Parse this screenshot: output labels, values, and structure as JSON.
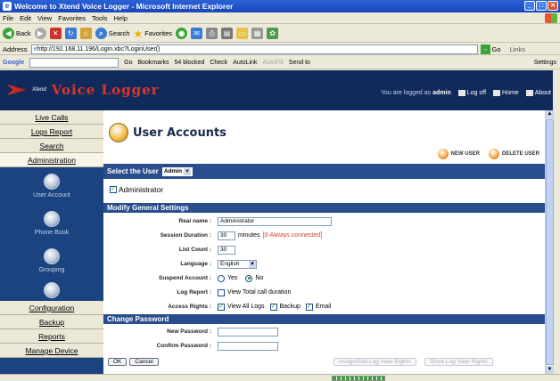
{
  "window": {
    "title": "Welcome to Xtend Voice Logger - Microsoft Internet Explorer"
  },
  "menu": [
    "File",
    "Edit",
    "View",
    "Favorites",
    "Tools",
    "Help"
  ],
  "toolbar": {
    "back": "Back",
    "search": "Search",
    "favorites": "Favorites"
  },
  "address": {
    "label": "Address",
    "url": "http://192.168.11.196/Login.xbc?LoginUser()",
    "go": "Go",
    "links": "Links"
  },
  "googlebar": {
    "brand": "Google",
    "go": "Go",
    "bookmarks": "Bookmarks",
    "blocked": "54 blocked",
    "check": "Check",
    "autolink": "AutoLink",
    "autofill": "AutoFill",
    "sendto": "Send to",
    "settings": "Settings"
  },
  "header": {
    "brand_small": "Xtend",
    "brand_big": "Voice Logger",
    "logged_in_text": "You are logged as",
    "user": "admin",
    "logoff": "Log off",
    "home": "Home",
    "about": "About"
  },
  "sidebar": {
    "top_links": [
      "Live Calls",
      "Logs Report",
      "Search",
      "Administration"
    ],
    "items": [
      "User Account",
      "Phone Book",
      "Grouping"
    ],
    "bottom_links": [
      "Configuration",
      "Backup",
      "Reports",
      "Manage Device"
    ]
  },
  "page": {
    "title": "User Accounts",
    "new_user": "NEW USER",
    "delete_user": "DELETE USER"
  },
  "select_user": {
    "label": "Select the User",
    "value": "Admin"
  },
  "admin_checkbox": "Administrator",
  "general": {
    "heading": "Modify General Settings",
    "realname_label": "Real name :",
    "realname": "Administrator",
    "session_label": "Session Duration :",
    "session": "30",
    "session_unit": "minutes",
    "session_hint": "[0-Always connected]",
    "listcount_label": "List Count :",
    "listcount": "30",
    "language_label": "Language :",
    "language": "English",
    "suspend_label": "Suspend Account :",
    "yes": "Yes",
    "no": "No",
    "logreport_label": "Log Report :",
    "logreport_text": "View Total call duration",
    "access_label": "Access Rights :",
    "view_all_logs": "View All Logs",
    "backup": "Backup",
    "email": "Email"
  },
  "password": {
    "heading": "Change Password",
    "new_label": "New Password :",
    "confirm_label": "Confirm Password :"
  },
  "buttons": {
    "ok": "OK",
    "cancel": "Cancel",
    "assign": "Assign/Edit Log View Rights",
    "show": "Show Log View Rights"
  }
}
